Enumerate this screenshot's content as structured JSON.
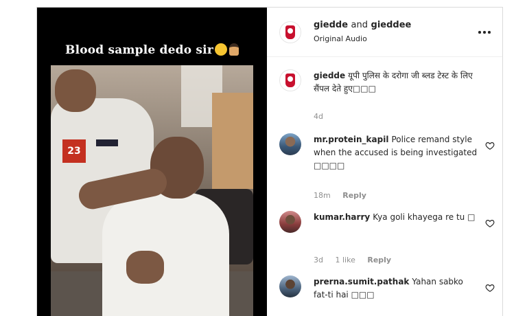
{
  "media": {
    "overlay_text": "Blood sample dedo sir",
    "badge_text": "23"
  },
  "header": {
    "user1": "giedde",
    "joiner": "and",
    "user2": "gieddee",
    "audio": "Original Audio",
    "more_icon": "more-horizontal-icon"
  },
  "caption": {
    "username": "giedde",
    "text": "यूपी पुलिस के दरोगा जी ब्लड टेस्ट के लिए सैंपल देते हुए□□□",
    "time": "4d"
  },
  "comments": [
    {
      "username": "mr.protein_kapil",
      "text": "Police remand style when the accused is being investigated □□□□",
      "time": "18m",
      "likes": "",
      "reply": "Reply"
    },
    {
      "username": "kumar.harry",
      "text": "Kya goli khayega re tu □",
      "time": "3d",
      "likes": "1 like",
      "reply": "Reply"
    },
    {
      "username": "prerna.sumit.pathak",
      "text": "Yahan sabko fat-ti hai □□□",
      "time": "",
      "likes": "",
      "reply": ""
    }
  ],
  "colors": {
    "text": "#262626",
    "meta": "#8e8e8e",
    "border": "#dbdbdb",
    "logo_red": "#c8102e"
  },
  "icons": [
    "more-horizontal-icon",
    "heart-icon"
  ]
}
